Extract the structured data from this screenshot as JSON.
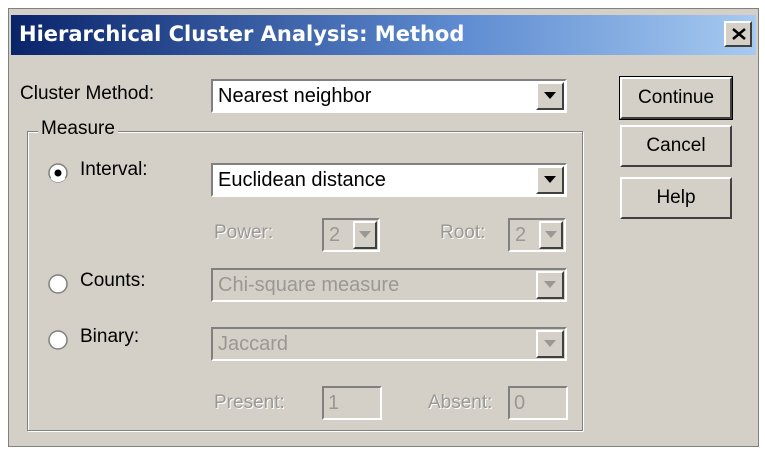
{
  "dialog": {
    "title": "Hierarchical Cluster Analysis: Method"
  },
  "cluster_method": {
    "label": "Cluster Method:",
    "value": "Nearest neighbor"
  },
  "measure": {
    "group_label": "Measure",
    "interval": {
      "label": "Interval:",
      "selected": true,
      "value": "Euclidean distance"
    },
    "power": {
      "label": "Power:",
      "value": "2"
    },
    "root": {
      "label": "Root:",
      "value": "2"
    },
    "counts": {
      "label": "Counts:",
      "selected": false,
      "value": "Chi-square measure"
    },
    "binary": {
      "label": "Binary:",
      "selected": false,
      "value": "Jaccard"
    },
    "present": {
      "label": "Present:",
      "value": "1"
    },
    "absent": {
      "label": "Absent:",
      "value": "0"
    }
  },
  "buttons": {
    "continue": "Continue",
    "cancel": "Cancel",
    "help": "Help"
  }
}
